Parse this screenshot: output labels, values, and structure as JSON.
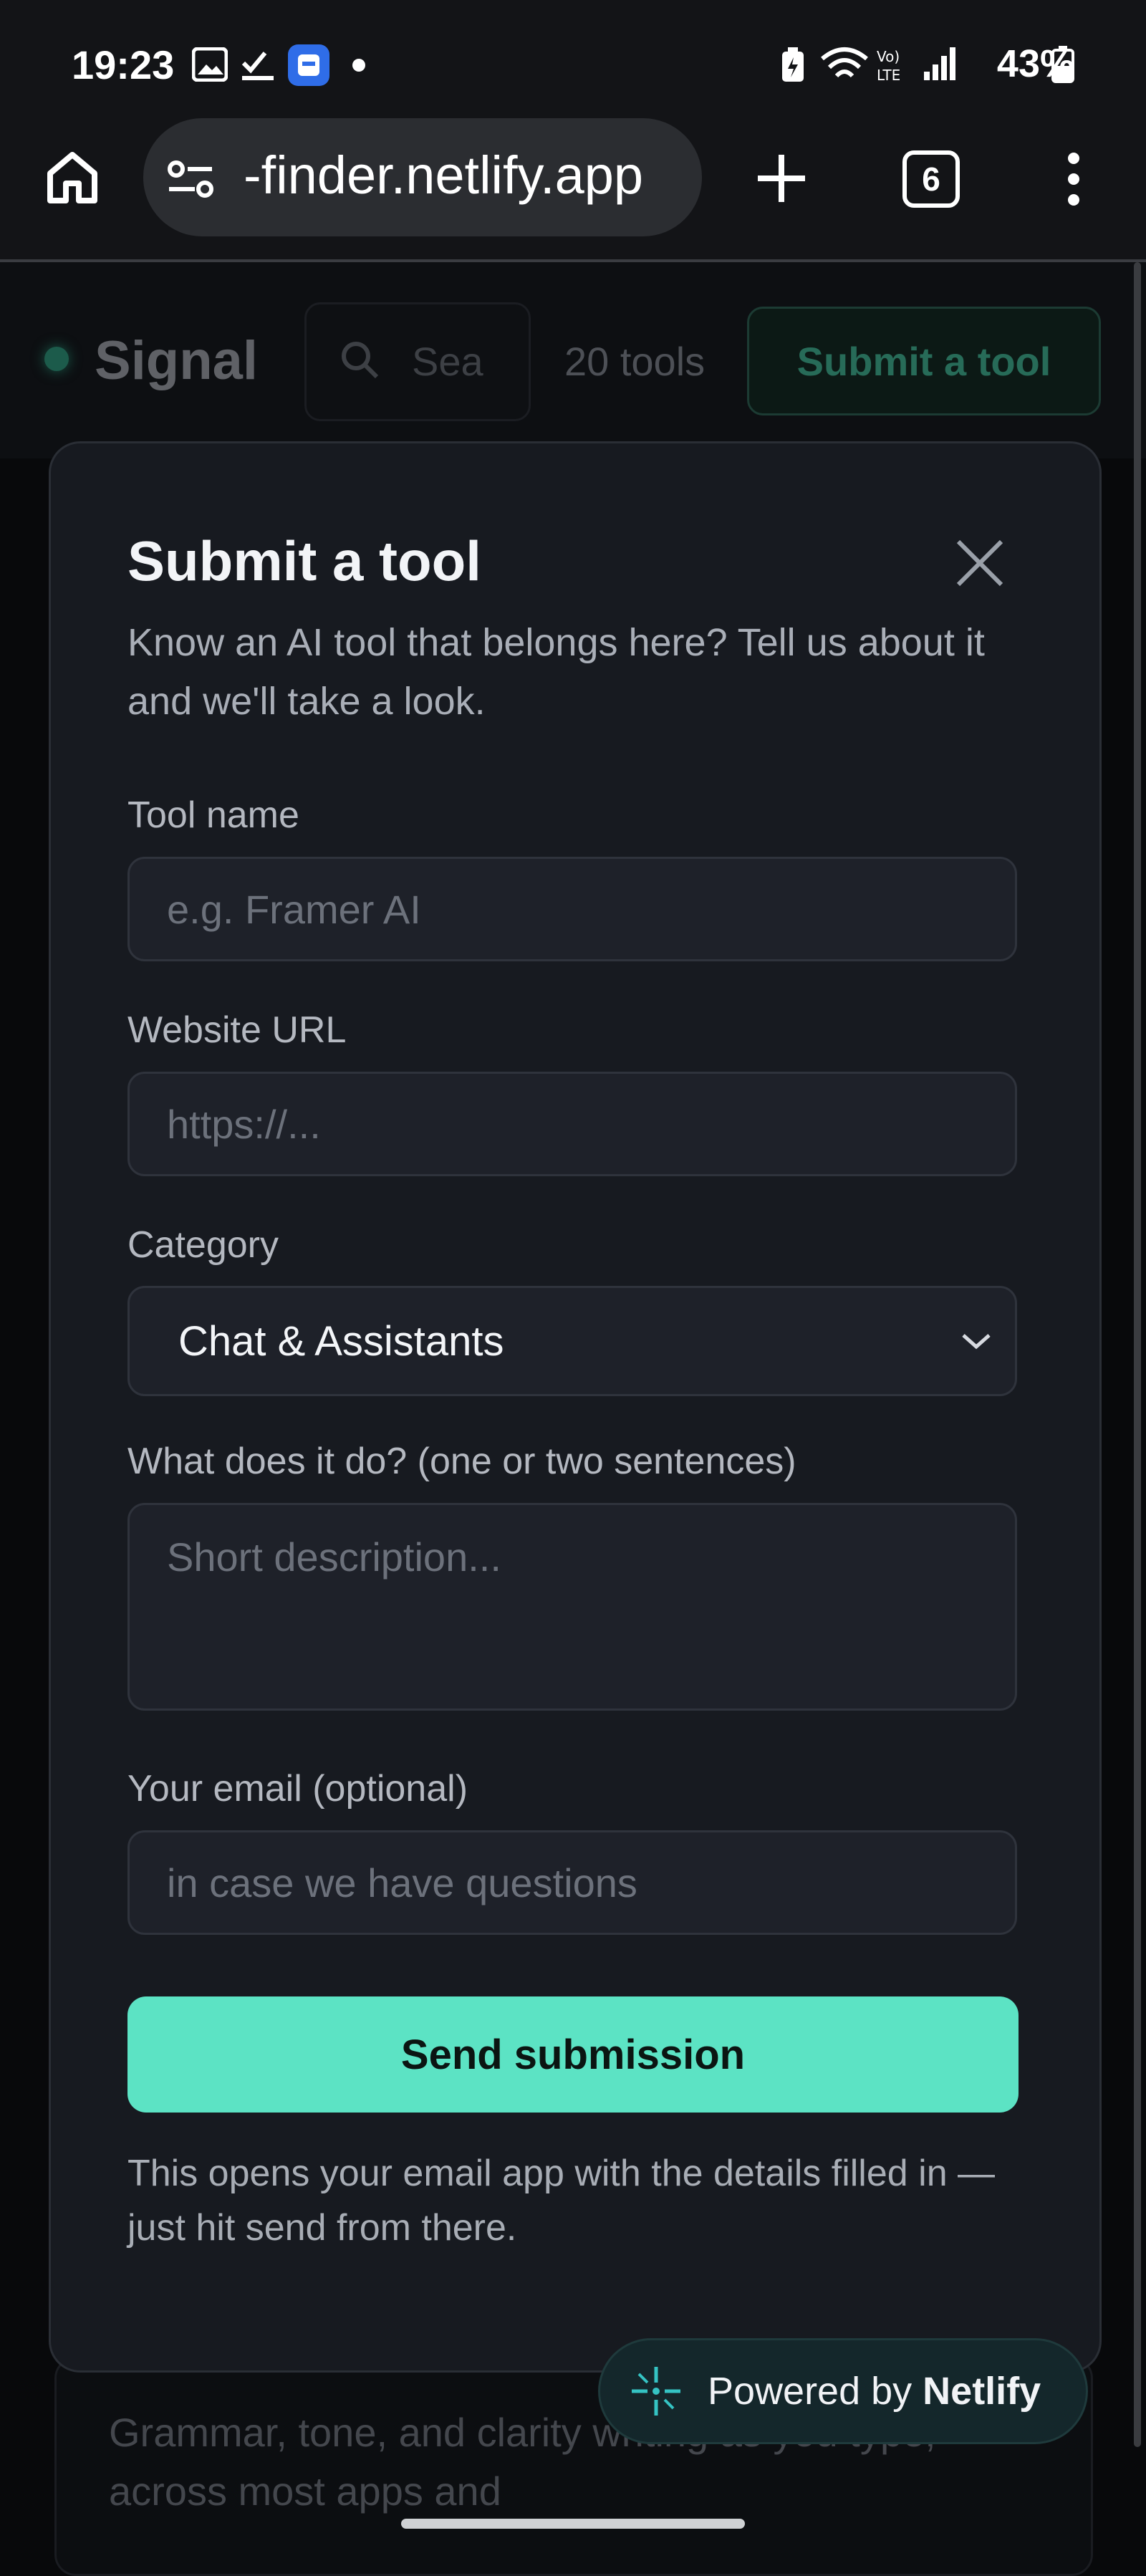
{
  "status_bar": {
    "time": "19:23",
    "battery": "43%"
  },
  "browser": {
    "url": "-finder.netlify.app",
    "tab_count": "6"
  },
  "page": {
    "logo": "Signal",
    "search_placeholder": "Sea",
    "tools_count": "20 tools",
    "submit_label": "Submit a tool",
    "card_text": "Grammar, tone, and clarity writing as you type, across most apps and"
  },
  "modal": {
    "title": "Submit a tool",
    "subtitle": "Know an AI tool that belongs here? Tell us about it and we'll take a look.",
    "fields": {
      "tool_name": {
        "label": "Tool name",
        "placeholder": "e.g. Framer AI"
      },
      "website_url": {
        "label": "Website URL",
        "placeholder": "https://..."
      },
      "category": {
        "label": "Category",
        "value": "Chat & Assistants"
      },
      "description": {
        "label": "What does it do? (one or two sentences)",
        "placeholder": "Short description..."
      },
      "email": {
        "label": "Your email (optional)",
        "placeholder": "in case we have questions"
      }
    },
    "submit_label": "Send submission",
    "footnote": "This opens your email app with the details filled in — just hit send from there."
  },
  "badge": {
    "prefix": "Powered by ",
    "brand": "Netlify"
  },
  "colors": {
    "accent": "#5ce3c4",
    "modal_bg": "#171a20",
    "field_bg": "#1e2129"
  }
}
